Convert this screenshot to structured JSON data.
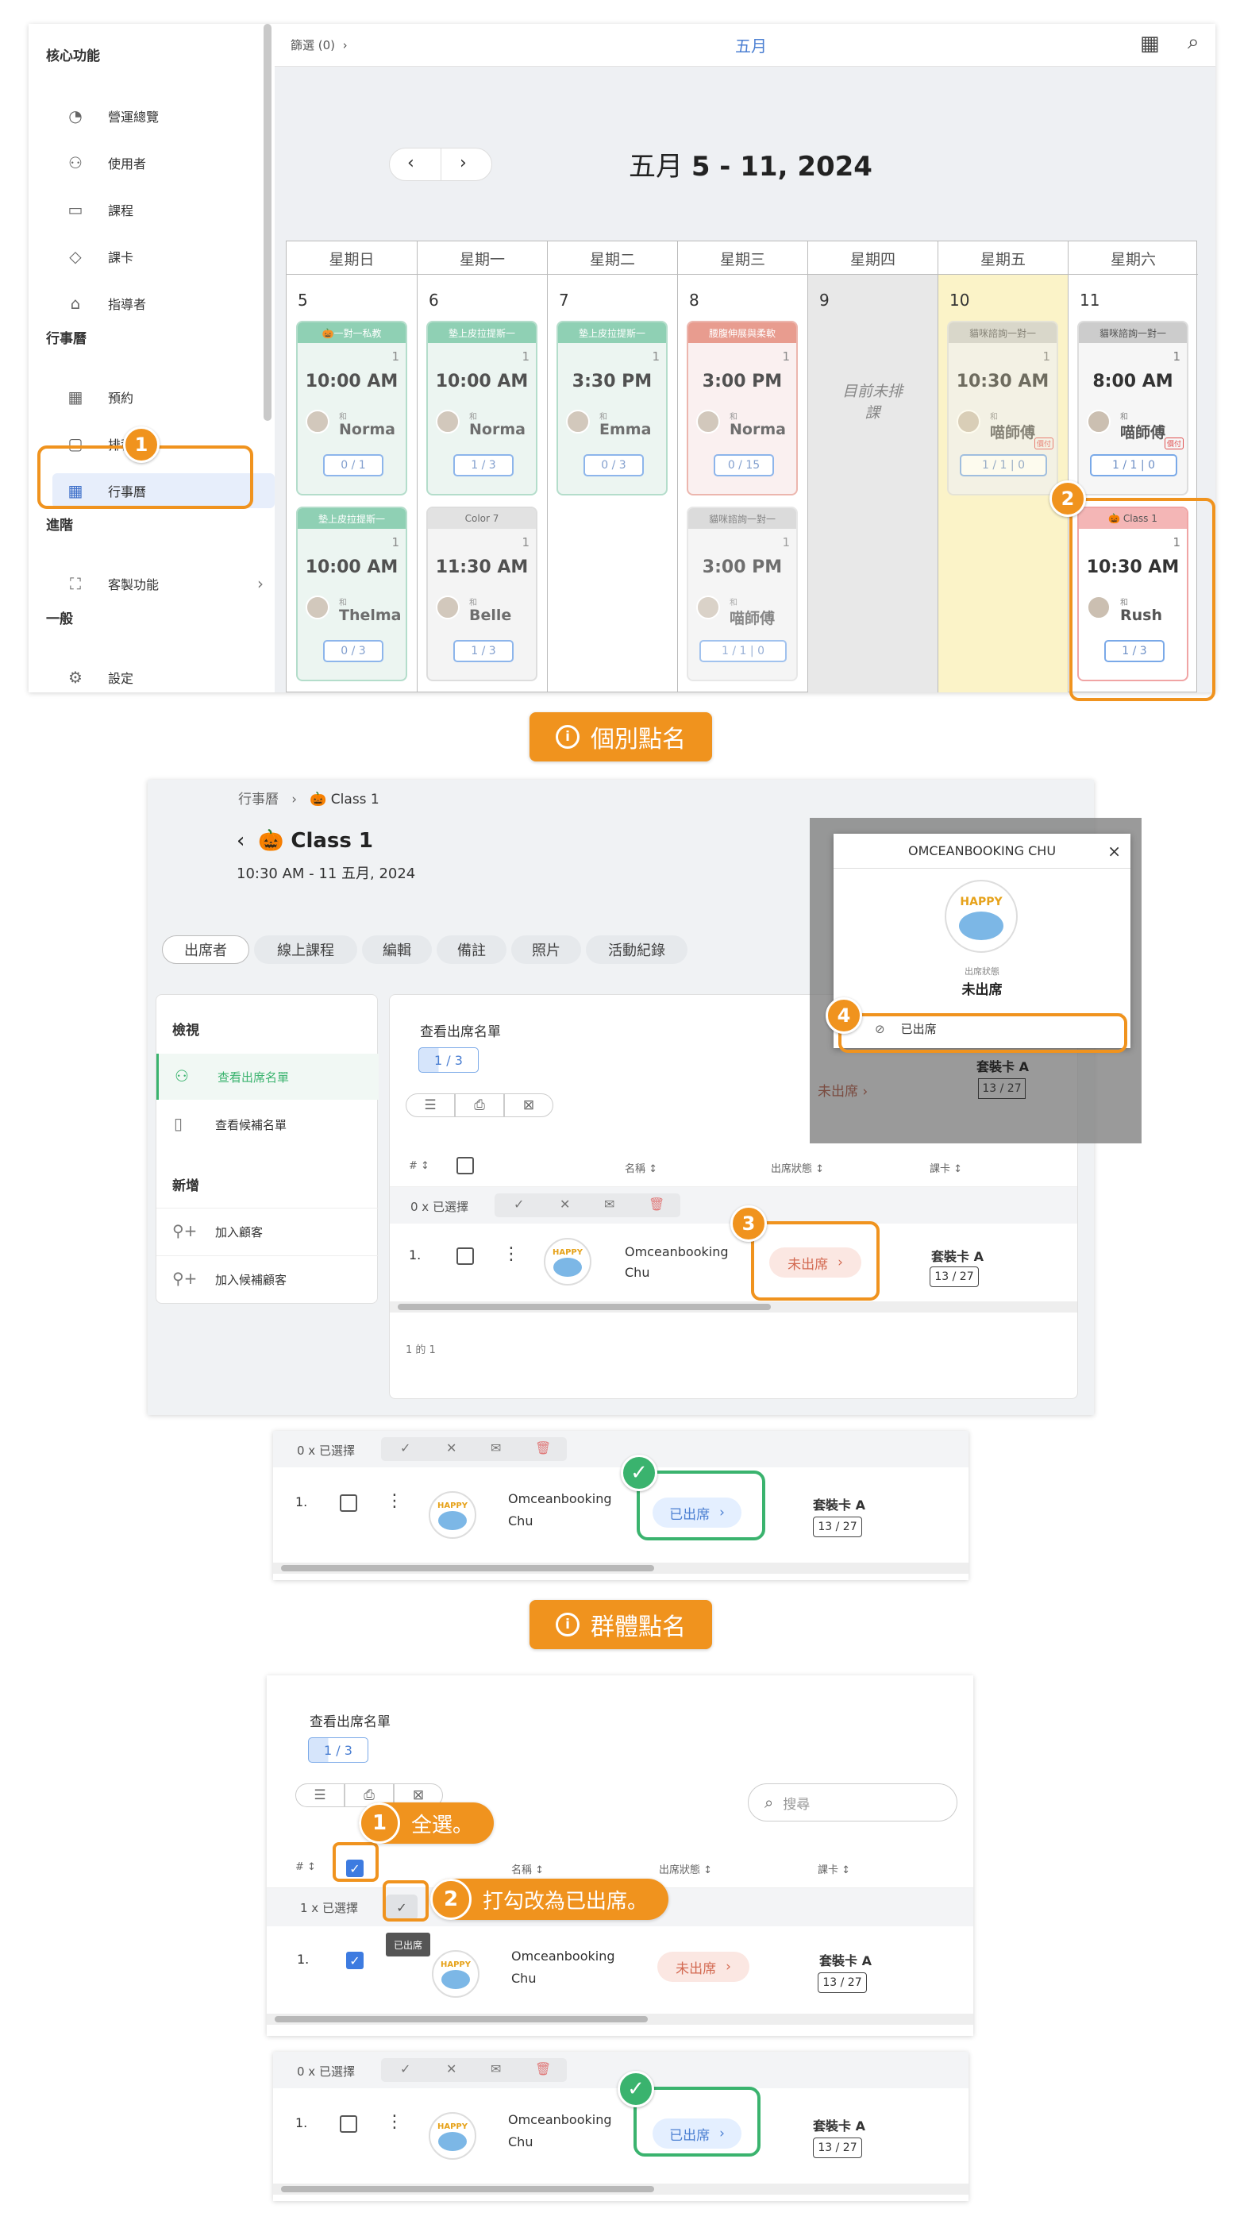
{
  "sidebar": {
    "sections": [
      "核心功能",
      "行事曆",
      "進階",
      "一般"
    ],
    "items": [
      {
        "label": "營運總覽",
        "icon": "dashboard-icon"
      },
      {
        "label": "使用者",
        "icon": "users-icon"
      },
      {
        "label": "課程",
        "icon": "classroom-icon"
      },
      {
        "label": "課卡",
        "icon": "tag-icon"
      },
      {
        "label": "指導者",
        "icon": "graduation-cap-icon"
      },
      {
        "label": "預約",
        "icon": "calendar-31-icon"
      },
      {
        "label": "排程",
        "icon": "schedule-icon"
      },
      {
        "label": "行事曆",
        "icon": "calendar-grid-icon"
      },
      {
        "label": "客製功能",
        "icon": "gift-icon"
      },
      {
        "label": "設定",
        "icon": "gear-icon"
      }
    ]
  },
  "calendar": {
    "filter_label": "篩選 (0)",
    "month_label": "五月",
    "title_prefix": "五月",
    "title_range": "5 - 11, 2024",
    "days": [
      "星期日",
      "星期一",
      "星期二",
      "星期三",
      "星期四",
      "星期五",
      "星期六"
    ],
    "dates": [
      "5",
      "6",
      "7",
      "8",
      "9",
      "10",
      "11"
    ],
    "no_schedule": "目前未排課",
    "events": [
      {
        "title": "🎃一對一私教",
        "count": "1",
        "time": "10:00 AM",
        "with": "和",
        "who": "Norma",
        "cap": "0 / 1",
        "color": "#7cc8a7"
      },
      {
        "title": "墊上皮拉提斯一",
        "count": "1",
        "time": "10:00 AM",
        "with": "和",
        "who": "Norma",
        "cap": "1 / 3",
        "color": "#7cc8a7"
      },
      {
        "title": "墊上皮拉提斯一",
        "count": "1",
        "time": "3:30 PM",
        "with": "和",
        "who": "Emma",
        "cap": "0 / 3",
        "color": "#7cc8a7"
      },
      {
        "title": "腰腹伸展與柔軟",
        "count": "1",
        "time": "3:00 PM",
        "with": "和",
        "who": "Norma",
        "cap": "0 / 15",
        "color": "#e48b7c"
      },
      {
        "title": "墊上皮拉提斯一",
        "count": "1",
        "time": "10:00 AM",
        "with": "和",
        "who": "Thelma",
        "cap": "0 / 3",
        "color": "#7cc8a7"
      },
      {
        "title": "Color 7",
        "count": "1",
        "time": "11:30 AM",
        "with": "和",
        "who": "Belle",
        "cap": "1 / 3",
        "color": "#dddddd"
      },
      {
        "title": "貓咪諮詢一對一",
        "count": "1",
        "time": "3:00 PM",
        "with": "和",
        "who": "喵師傅",
        "cap": "1 / 1  |  0",
        "color": "#cccccc"
      },
      {
        "title": "貓咪諮詢一對一",
        "count": "1",
        "time": "10:30 AM",
        "with": "和",
        "who": "喵師傅",
        "cap": "1 / 1  |  0",
        "color": "#cccccc"
      },
      {
        "title": "貓咪諮詢一對一",
        "count": "1",
        "time": "8:00 AM",
        "with": "和",
        "who": "喵師傅",
        "cap": "1 / 1  |  0",
        "color": "#cccccc"
      },
      {
        "title": "🎃 Class 1",
        "count": "1",
        "time": "10:30 AM",
        "with": "和",
        "who": "Rush",
        "cap": "1 / 3",
        "color": "#f4b6b6"
      }
    ],
    "tag_small": "價付"
  },
  "banners": {
    "individual": "個別點名",
    "group": "群體點名"
  },
  "detail": {
    "breadcrumb_root": "行事曆",
    "breadcrumb_current": "🎃 Class 1",
    "title": "🎃 Class 1",
    "datetime": "10:30 AM - 11 五月, 2024",
    "tabs": [
      "出席者",
      "線上課程",
      "編輯",
      "備註",
      "照片",
      "活動紀錄"
    ],
    "view_heading": "檢視",
    "view_items": [
      "查看出席名單",
      "查看候補名單"
    ],
    "add_heading": "新增",
    "add_items": [
      "加入顧客",
      "加入候補顧客"
    ],
    "list_title": "查看出席名單",
    "list_count": "1 / 3",
    "col_hash": "# ↕",
    "col_name": "名稱 ↕",
    "col_status": "出席狀態 ↕",
    "col_card": "課卡 ↕",
    "selected_label": "0 x 已選擇",
    "row_index": "1.",
    "row_name_1": "Omceanbooking",
    "row_name_2": "Chu",
    "status_absent": "未出席",
    "card_name": "套裝卡 A",
    "card_count": "13 / 27",
    "pager": "1 的 1"
  },
  "popup": {
    "title": "OMCEANBOOKING CHU",
    "status_label": "出席狀態",
    "status_value": "未出席",
    "option_present": "已出席"
  },
  "result1": {
    "selected_label": "0 x 已選擇",
    "status": "已出席"
  },
  "group": {
    "list_title": "查看出席名單",
    "list_count": "1 / 3",
    "search_placeholder": "搜尋",
    "selected_label": "1 x 已選擇",
    "tooltip": "已出席",
    "callout_1": "全選。",
    "callout_2": "打勾改為已出席。",
    "status_absent": "未出席"
  },
  "result2": {
    "selected_label": "0 x 已選擇",
    "status": "已出席"
  }
}
